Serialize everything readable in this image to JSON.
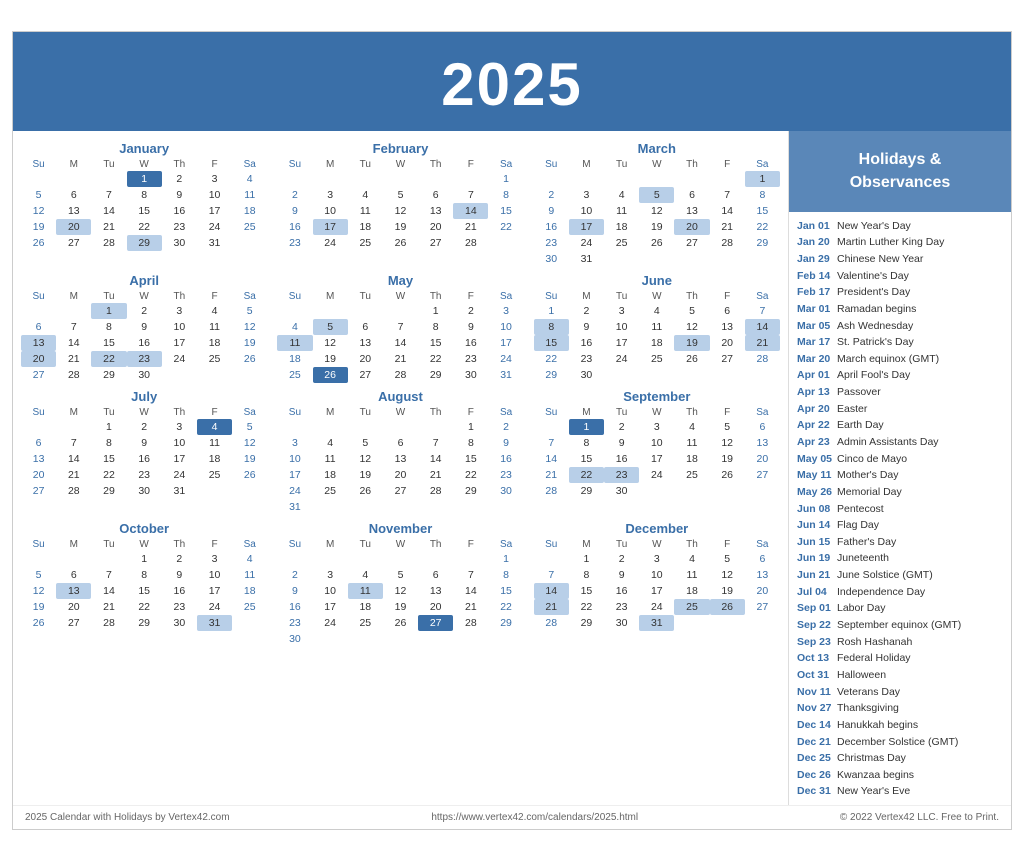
{
  "header": {
    "year": "2025"
  },
  "sidebar": {
    "title": "Holidays &\nObservances",
    "items": [
      {
        "date": "Jan 01",
        "event": "New Year's Day"
      },
      {
        "date": "Jan 20",
        "event": "Martin Luther King Day"
      },
      {
        "date": "Jan 29",
        "event": "Chinese New Year"
      },
      {
        "date": "Feb 14",
        "event": "Valentine's Day"
      },
      {
        "date": "Feb 17",
        "event": "President's Day"
      },
      {
        "date": "Mar 01",
        "event": "Ramadan begins"
      },
      {
        "date": "Mar 05",
        "event": "Ash Wednesday"
      },
      {
        "date": "Mar 17",
        "event": "St. Patrick's Day"
      },
      {
        "date": "Mar 20",
        "event": "March equinox (GMT)"
      },
      {
        "date": "Apr 01",
        "event": "April Fool's Day"
      },
      {
        "date": "Apr 13",
        "event": "Passover"
      },
      {
        "date": "Apr 20",
        "event": "Easter"
      },
      {
        "date": "Apr 22",
        "event": "Earth Day"
      },
      {
        "date": "Apr 23",
        "event": "Admin Assistants Day"
      },
      {
        "date": "May 05",
        "event": "Cinco de Mayo"
      },
      {
        "date": "May 11",
        "event": "Mother's Day"
      },
      {
        "date": "May 26",
        "event": "Memorial Day"
      },
      {
        "date": "Jun 08",
        "event": "Pentecost"
      },
      {
        "date": "Jun 14",
        "event": "Flag Day"
      },
      {
        "date": "Jun 15",
        "event": "Father's Day"
      },
      {
        "date": "Jun 19",
        "event": "Juneteenth"
      },
      {
        "date": "Jun 21",
        "event": "June Solstice (GMT)"
      },
      {
        "date": "Jul 04",
        "event": "Independence Day"
      },
      {
        "date": "Sep 01",
        "event": "Labor Day"
      },
      {
        "date": "Sep 22",
        "event": "September equinox (GMT)"
      },
      {
        "date": "Sep 23",
        "event": "Rosh Hashanah"
      },
      {
        "date": "Oct 13",
        "event": "Federal Holiday"
      },
      {
        "date": "Oct 31",
        "event": "Halloween"
      },
      {
        "date": "Nov 11",
        "event": "Veterans Day"
      },
      {
        "date": "Nov 27",
        "event": "Thanksgiving"
      },
      {
        "date": "Dec 14",
        "event": "Hanukkah begins"
      },
      {
        "date": "Dec 21",
        "event": "December Solstice (GMT)"
      },
      {
        "date": "Dec 25",
        "event": "Christmas Day"
      },
      {
        "date": "Dec 26",
        "event": "Kwanzaa begins"
      },
      {
        "date": "Dec 31",
        "event": "New Year's Eve"
      }
    ]
  },
  "footer": {
    "left": "2025 Calendar with Holidays by Vertex42.com",
    "center": "https://www.vertex42.com/calendars/2025.html",
    "right": "© 2022 Vertex42 LLC. Free to Print."
  },
  "months": [
    {
      "name": "January",
      "days": [
        [
          null,
          null,
          null,
          1,
          2,
          3,
          4
        ],
        [
          5,
          6,
          7,
          8,
          9,
          10,
          11
        ],
        [
          12,
          13,
          14,
          15,
          16,
          17,
          18
        ],
        [
          19,
          20,
          21,
          22,
          23,
          24,
          25
        ],
        [
          26,
          27,
          28,
          29,
          30,
          31,
          null
        ]
      ],
      "highlights": {
        "1": "dark",
        "20": "blue",
        "29": "blue"
      }
    },
    {
      "name": "February",
      "days": [
        [
          null,
          null,
          null,
          null,
          null,
          null,
          1
        ],
        [
          2,
          3,
          4,
          5,
          6,
          7,
          8
        ],
        [
          9,
          10,
          11,
          12,
          13,
          14,
          15
        ],
        [
          16,
          17,
          18,
          19,
          20,
          21,
          22
        ],
        [
          23,
          24,
          25,
          26,
          27,
          28,
          null
        ]
      ],
      "highlights": {
        "14": "blue",
        "17": "blue"
      }
    },
    {
      "name": "March",
      "days": [
        [
          null,
          null,
          null,
          null,
          null,
          null,
          1
        ],
        [
          2,
          3,
          4,
          5,
          6,
          7,
          8
        ],
        [
          9,
          10,
          11,
          12,
          13,
          14,
          15
        ],
        [
          16,
          17,
          18,
          19,
          20,
          21,
          22
        ],
        [
          23,
          24,
          25,
          26,
          27,
          28,
          29
        ],
        [
          30,
          31,
          null,
          null,
          null,
          null,
          null
        ]
      ],
      "highlights": {
        "1": "blue",
        "5": "blue",
        "17": "blue",
        "20": "blue"
      }
    },
    {
      "name": "April",
      "days": [
        [
          null,
          null,
          1,
          2,
          3,
          4,
          5
        ],
        [
          6,
          7,
          8,
          9,
          10,
          11,
          12
        ],
        [
          13,
          14,
          15,
          16,
          17,
          18,
          19
        ],
        [
          20,
          21,
          22,
          23,
          24,
          25,
          26
        ],
        [
          27,
          28,
          29,
          30,
          null,
          null,
          null
        ]
      ],
      "highlights": {
        "1": "blue",
        "13": "blue",
        "20": "blue",
        "22": "blue",
        "23": "blue"
      }
    },
    {
      "name": "May",
      "days": [
        [
          null,
          null,
          null,
          null,
          1,
          2,
          3
        ],
        [
          4,
          5,
          6,
          7,
          8,
          9,
          10
        ],
        [
          11,
          12,
          13,
          14,
          15,
          16,
          17
        ],
        [
          18,
          19,
          20,
          21,
          22,
          23,
          24
        ],
        [
          25,
          26,
          27,
          28,
          29,
          30,
          31
        ]
      ],
      "highlights": {
        "5": "blue",
        "11": "blue",
        "26": "dark"
      }
    },
    {
      "name": "June",
      "days": [
        [
          1,
          2,
          3,
          4,
          5,
          6,
          7
        ],
        [
          8,
          9,
          10,
          11,
          12,
          13,
          14
        ],
        [
          15,
          16,
          17,
          18,
          19,
          20,
          21
        ],
        [
          22,
          23,
          24,
          25,
          26,
          27,
          28
        ],
        [
          29,
          30,
          null,
          null,
          null,
          null,
          null
        ]
      ],
      "highlights": {
        "8": "blue",
        "14": "blue",
        "15": "blue",
        "19": "blue",
        "21": "blue"
      }
    },
    {
      "name": "July",
      "days": [
        [
          null,
          null,
          1,
          2,
          3,
          4,
          5
        ],
        [
          6,
          7,
          8,
          9,
          10,
          11,
          12
        ],
        [
          13,
          14,
          15,
          16,
          17,
          18,
          19
        ],
        [
          20,
          21,
          22,
          23,
          24,
          25,
          26
        ],
        [
          27,
          28,
          29,
          30,
          31,
          null,
          null
        ]
      ],
      "highlights": {
        "4": "dark"
      }
    },
    {
      "name": "August",
      "days": [
        [
          null,
          null,
          null,
          null,
          null,
          1,
          2
        ],
        [
          3,
          4,
          5,
          6,
          7,
          8,
          9
        ],
        [
          10,
          11,
          12,
          13,
          14,
          15,
          16
        ],
        [
          17,
          18,
          19,
          20,
          21,
          22,
          23
        ],
        [
          24,
          25,
          26,
          27,
          28,
          29,
          30
        ],
        [
          31,
          null,
          null,
          null,
          null,
          null,
          null
        ]
      ],
      "highlights": {}
    },
    {
      "name": "September",
      "days": [
        [
          null,
          1,
          2,
          3,
          4,
          5,
          6
        ],
        [
          7,
          8,
          9,
          10,
          11,
          12,
          13
        ],
        [
          14,
          15,
          16,
          17,
          18,
          19,
          20
        ],
        [
          21,
          22,
          23,
          24,
          25,
          26,
          27
        ],
        [
          28,
          29,
          30,
          null,
          null,
          null,
          null
        ]
      ],
      "highlights": {
        "1": "dark",
        "22": "blue",
        "23": "blue"
      }
    },
    {
      "name": "October",
      "days": [
        [
          null,
          null,
          null,
          1,
          2,
          3,
          4
        ],
        [
          5,
          6,
          7,
          8,
          9,
          10,
          11
        ],
        [
          12,
          13,
          14,
          15,
          16,
          17,
          18
        ],
        [
          19,
          20,
          21,
          22,
          23,
          24,
          25
        ],
        [
          26,
          27,
          28,
          29,
          30,
          31,
          null
        ]
      ],
      "highlights": {
        "13": "blue",
        "31": "blue"
      }
    },
    {
      "name": "November",
      "days": [
        [
          null,
          null,
          null,
          null,
          null,
          null,
          1
        ],
        [
          2,
          3,
          4,
          5,
          6,
          7,
          8
        ],
        [
          9,
          10,
          11,
          12,
          13,
          14,
          15
        ],
        [
          16,
          17,
          18,
          19,
          20,
          21,
          22
        ],
        [
          23,
          24,
          25,
          26,
          27,
          28,
          29
        ],
        [
          30,
          null,
          null,
          null,
          null,
          null,
          null
        ]
      ],
      "highlights": {
        "11": "blue",
        "27": "dark"
      }
    },
    {
      "name": "December",
      "days": [
        [
          null,
          1,
          2,
          3,
          4,
          5,
          6
        ],
        [
          7,
          8,
          9,
          10,
          11,
          12,
          13
        ],
        [
          14,
          15,
          16,
          17,
          18,
          19,
          20
        ],
        [
          21,
          22,
          23,
          24,
          25,
          26,
          27
        ],
        [
          28,
          29,
          30,
          31,
          null,
          null,
          null
        ]
      ],
      "highlights": {
        "14": "blue",
        "21": "blue",
        "25": "blue",
        "26": "blue",
        "31": "blue"
      }
    }
  ]
}
